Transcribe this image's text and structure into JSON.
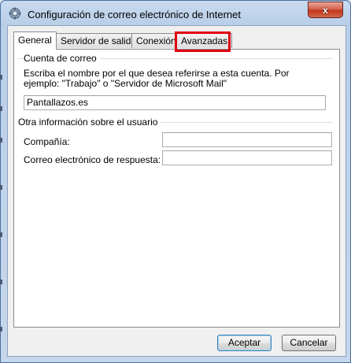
{
  "window": {
    "title": "Configuración de correo electrónico de Internet",
    "close_glyph": "x"
  },
  "tabs": [
    {
      "label": "General",
      "active": true
    },
    {
      "label": "Servidor de salida",
      "active": false
    },
    {
      "label": "Conexión",
      "active": false
    },
    {
      "label": "Avanzadas",
      "active": false,
      "highlighted": true
    }
  ],
  "highlight_color": "#e0000f",
  "mail_account": {
    "group_label": "Cuenta de correo",
    "description": "Escriba el nombre por el que desea referirse a esta cuenta. Por ejemplo: \"Trabajo\" o \"Servidor de Microsoft Mail\"",
    "account_name_value": "Pantallazos.es"
  },
  "user_info": {
    "group_label": "Otra información sobre el usuario",
    "company_label": "Compañía:",
    "company_value": "",
    "reply_email_label": "Correo electrónico de respuesta:",
    "reply_email_value": ""
  },
  "buttons": {
    "accept": "Aceptar",
    "cancel": "Cancelar"
  },
  "icons": {
    "window_icon": "envelope-gear-icon",
    "close": "close-icon"
  }
}
